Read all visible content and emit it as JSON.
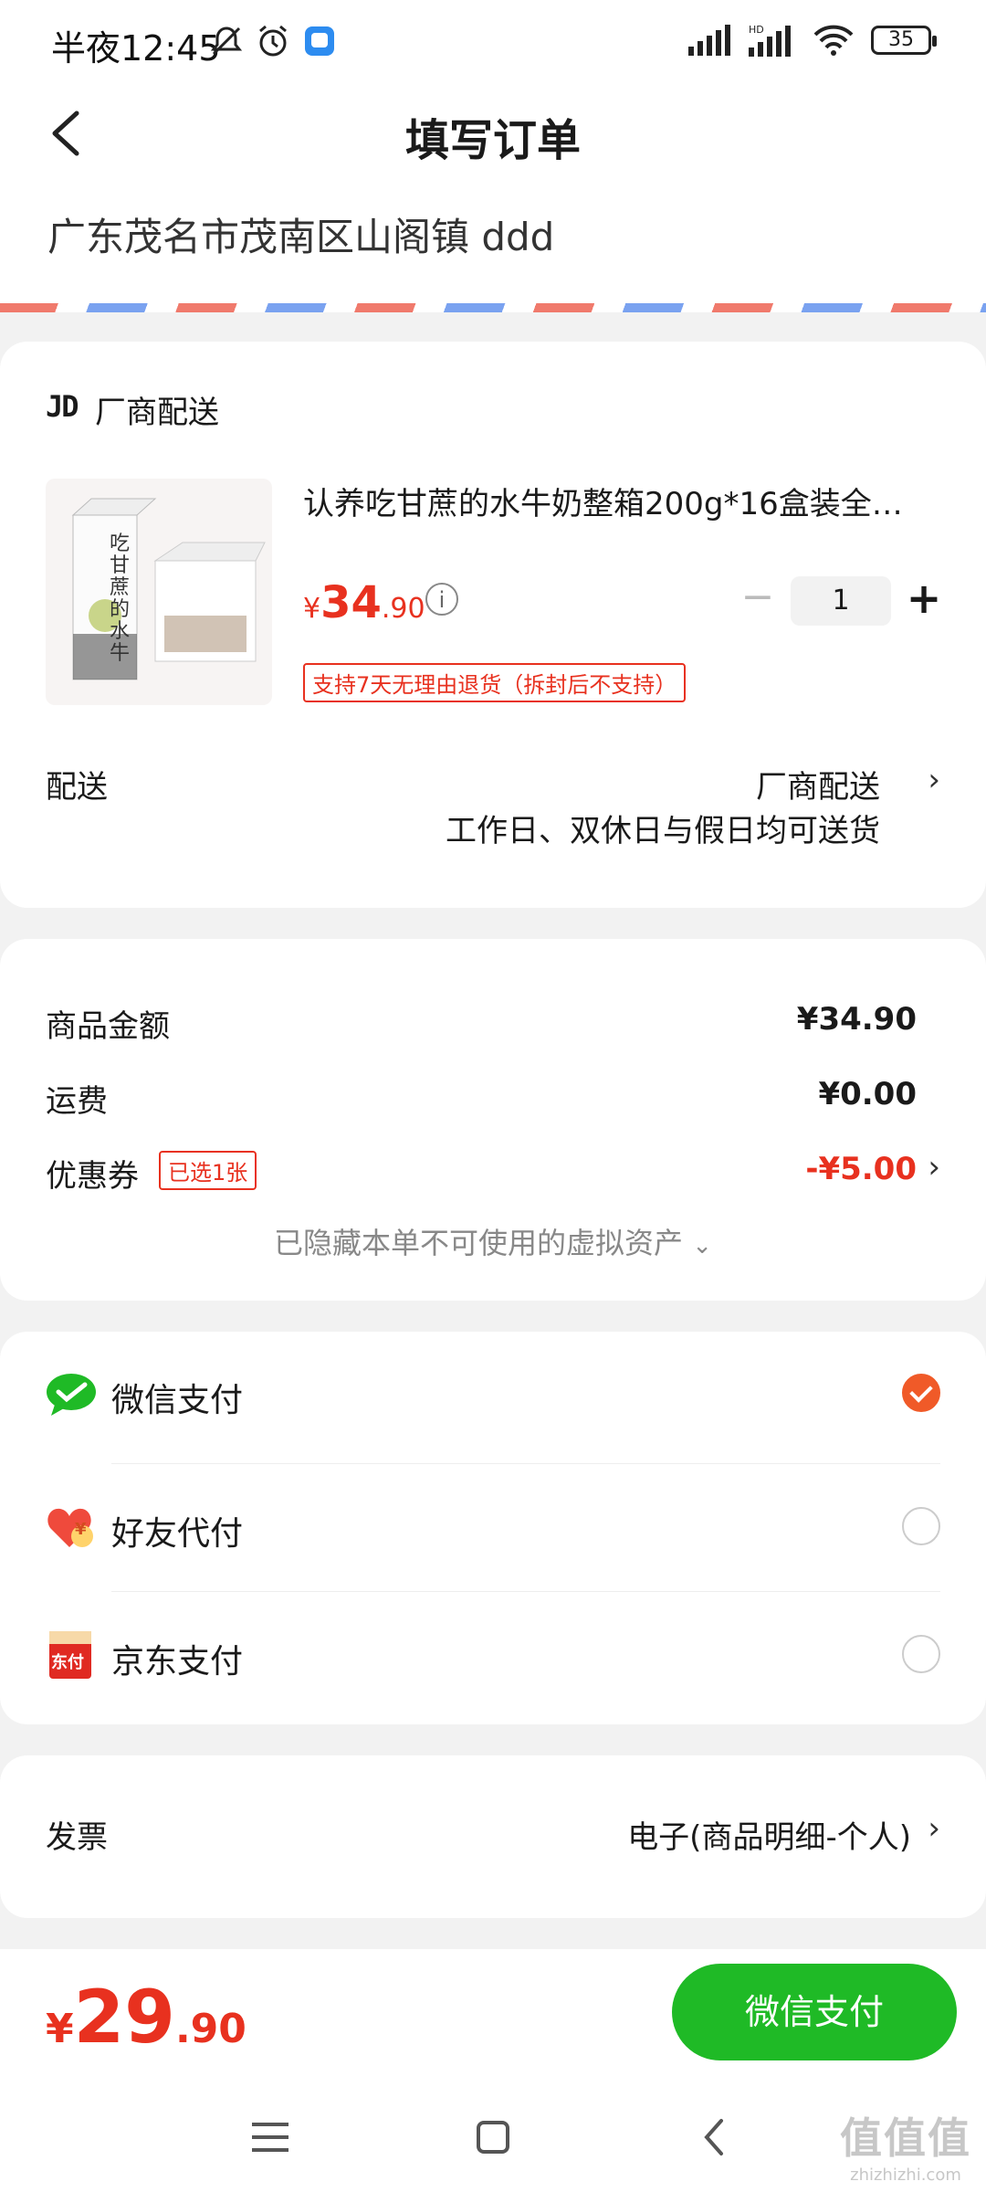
{
  "status_bar": {
    "time": "半夜12:45",
    "battery": "35"
  },
  "header": {
    "title": "填写订单"
  },
  "address": {
    "text": "广东茂名市茂南区山阁镇 ddd"
  },
  "shop": {
    "logo": "JD",
    "name": "厂商配送",
    "product": {
      "title": "认养吃甘蔗的水牛奶整箱200g*16盒装全…",
      "price_currency": "¥",
      "price_int": "34",
      "price_dec": ".90",
      "quantity": "1",
      "return_policy": "支持7天无理由退货（拆封后不支持）",
      "image_text": "吃甘蔗的水牛"
    },
    "delivery": {
      "label": "配送",
      "method": "厂商配送",
      "schedule": "工作日、双休日与假日均可送货"
    }
  },
  "summary": {
    "goods_label": "商品金额",
    "goods_value": "¥34.90",
    "shipping_label": "运费",
    "shipping_value": "¥0.00",
    "coupon_label": "优惠券",
    "coupon_tag": "已选1张",
    "coupon_value": "-¥5.00",
    "hidden_assets": "已隐藏本单不可使用的虚拟资产"
  },
  "payment": {
    "options": [
      {
        "label": "微信支付",
        "checked": true
      },
      {
        "label": "好友代付",
        "checked": false
      },
      {
        "label": "京东支付",
        "checked": false
      }
    ],
    "friend_icon_text": "¥",
    "jd_icon_text": "东付"
  },
  "invoice": {
    "label": "发票",
    "value": "电子(商品明细-个人)"
  },
  "footer": {
    "total_currency": "¥",
    "total_int": "29",
    "total_dec": ".90",
    "pay_button": "微信支付"
  },
  "watermark": {
    "big": "值值值",
    "small": "zhizhizhi.com"
  },
  "colors": {
    "price_red": "#e8311f",
    "pay_green": "#1fba26",
    "check_orange": "#f05a28"
  }
}
